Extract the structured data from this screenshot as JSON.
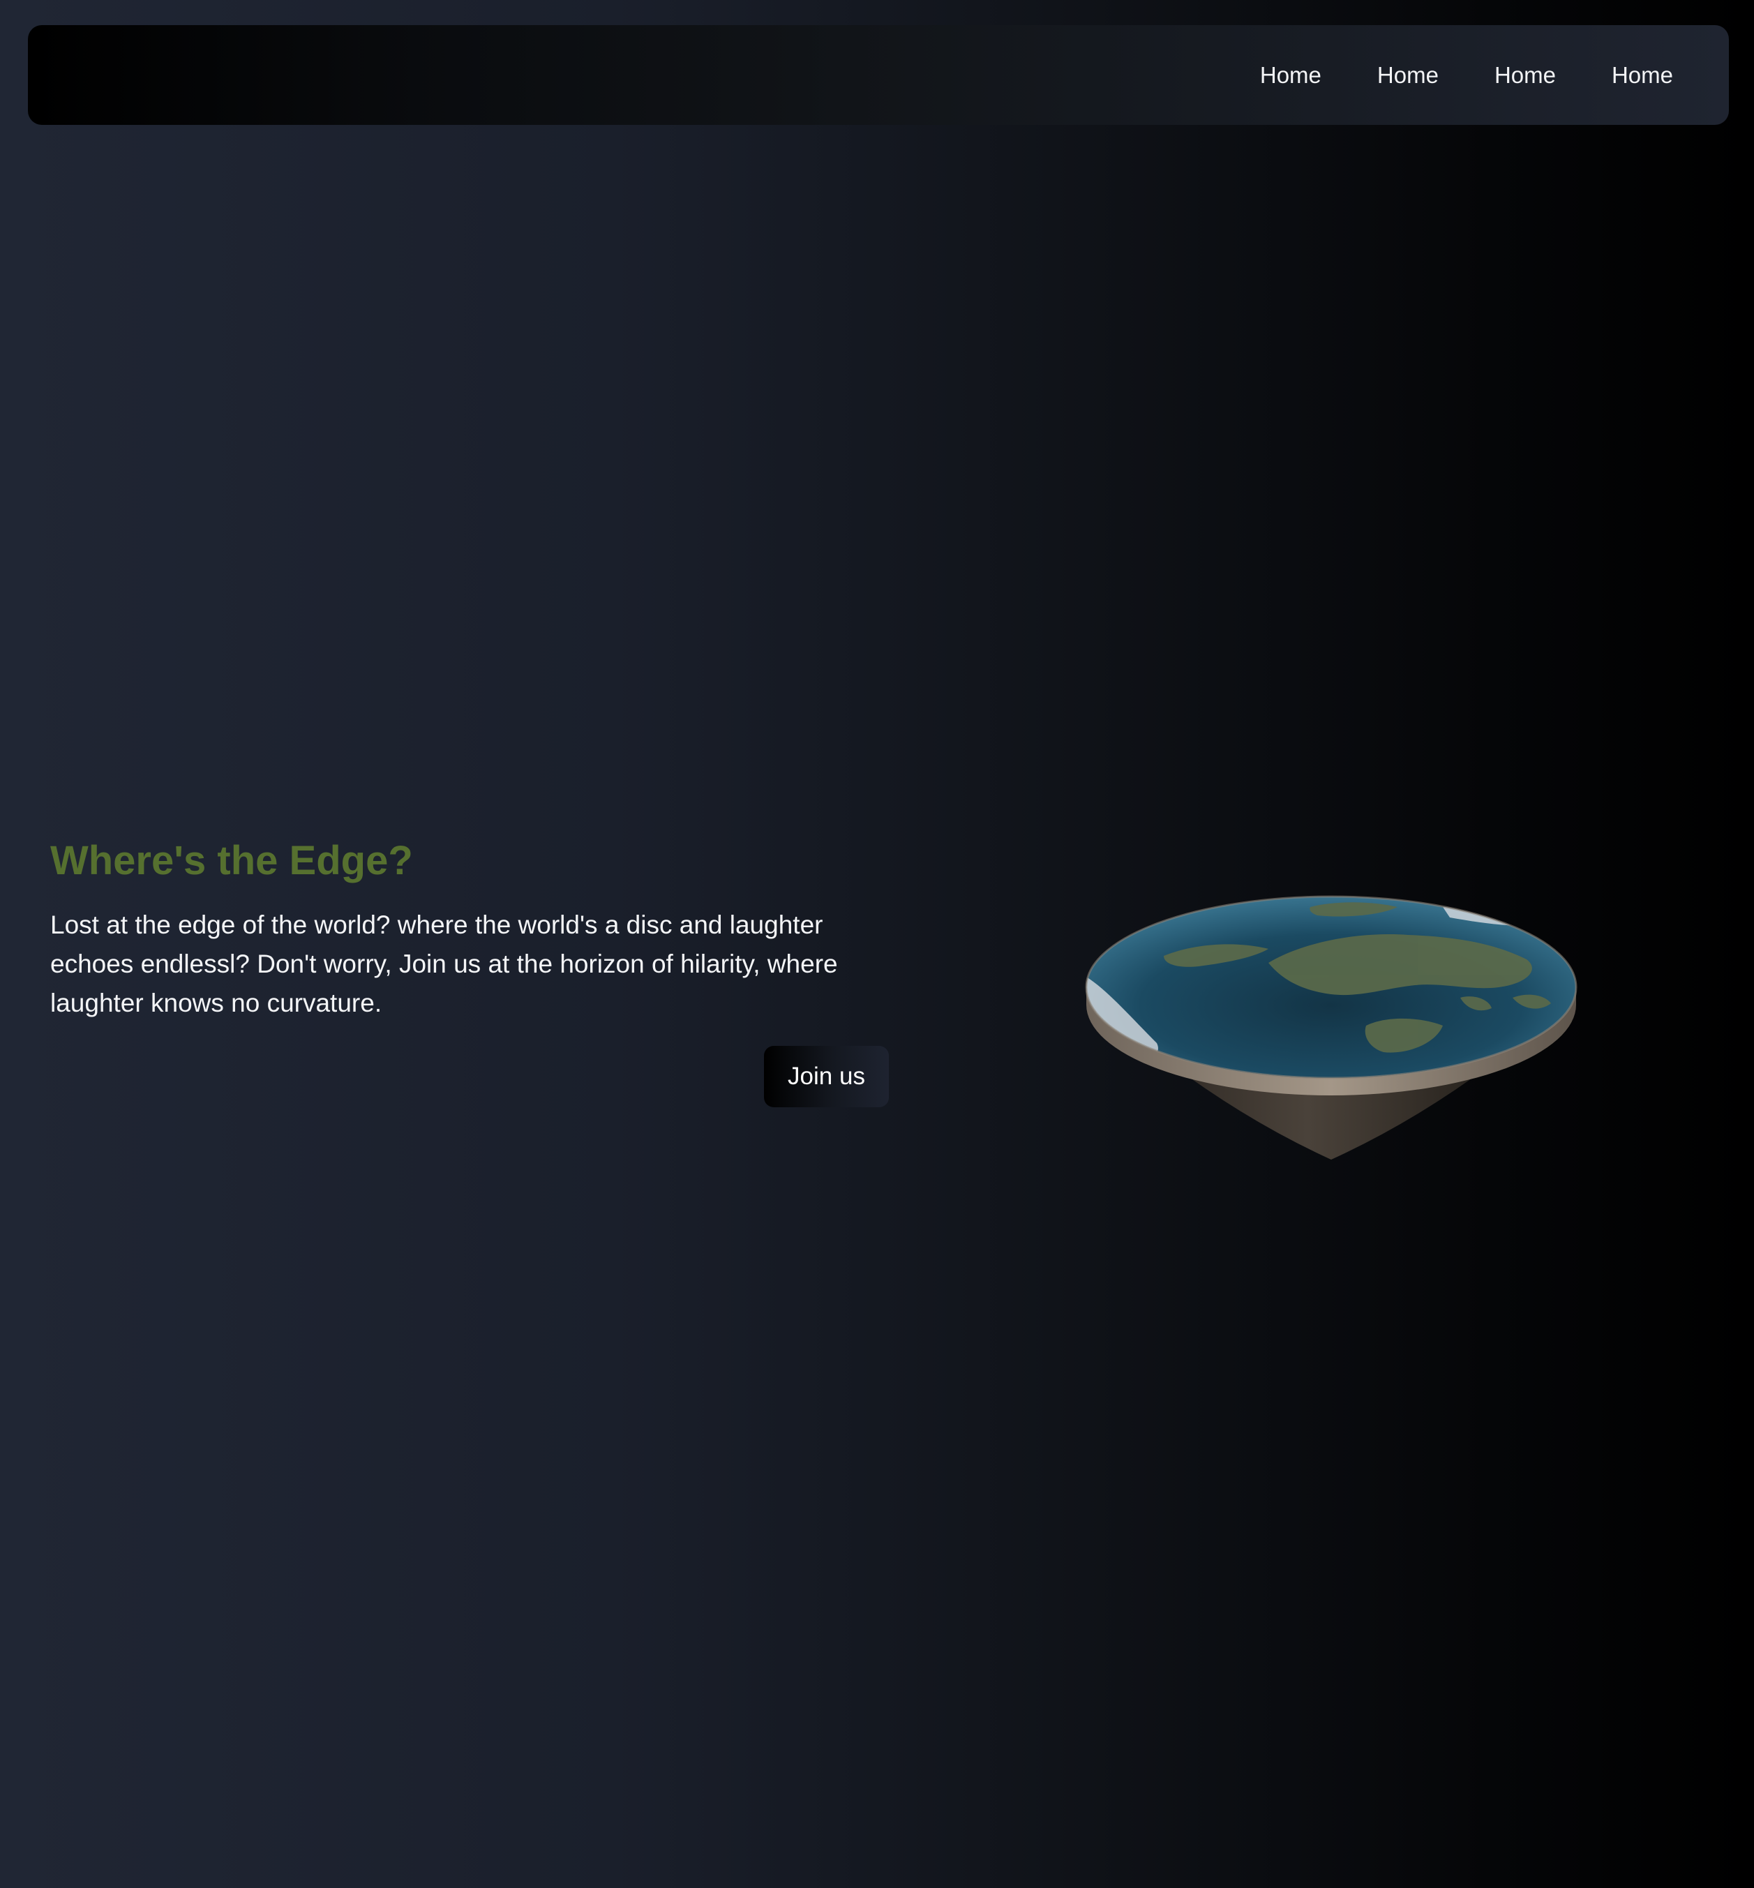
{
  "navbar": {
    "links": [
      "Home",
      "Home",
      "Home",
      "Home"
    ]
  },
  "hero": {
    "title": "Where's the Edge?",
    "description": "Lost at the edge of the world? where the world's a disc and laughter echoes endlessl? Don't worry, Join us at the horizon of hilarity, where laughter knows no curvature.",
    "cta_label": "Join us"
  },
  "colors": {
    "title": "#56702f",
    "text": "#f4f5f7",
    "background_dark": "#000000",
    "background_light": "#202634"
  },
  "icons": {
    "hero_image": "flat-earth-disc-icon"
  }
}
